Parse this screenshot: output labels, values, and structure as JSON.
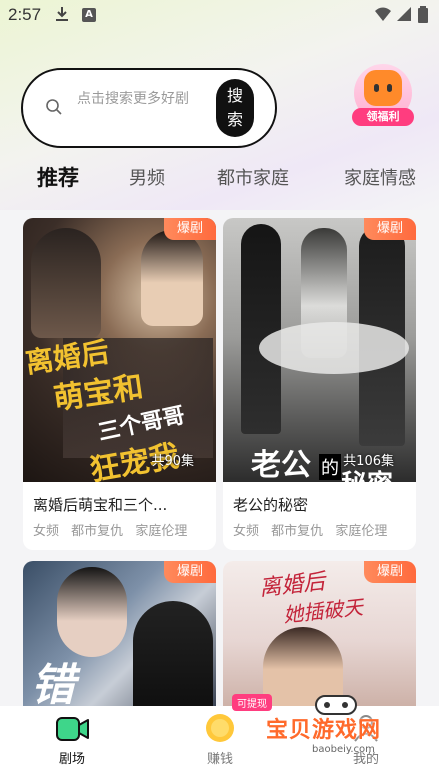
{
  "status_bar": {
    "time": "2:57"
  },
  "search": {
    "placeholder": "点击搜索更多好剧",
    "button_label": "搜索"
  },
  "welfare": {
    "label": "领福利"
  },
  "tabs": [
    {
      "label": "推荐",
      "active": true
    },
    {
      "label": "男频",
      "active": false
    },
    {
      "label": "都市家庭",
      "active": false
    },
    {
      "label": "家庭情感",
      "active": false
    }
  ],
  "cards": [
    {
      "badge": "爆剧",
      "cover_text": [
        "离婚后",
        "萌宝和",
        "三个哥哥",
        "狂宠我"
      ],
      "episodes": "共90集",
      "title": "离婚后萌宝和三个...",
      "tags": [
        "女频",
        "都市复仇",
        "家庭伦理"
      ]
    },
    {
      "badge": "爆剧",
      "cover_text": [
        "老公",
        "的",
        "秘密"
      ],
      "episodes": "共106集",
      "title": "老公的秘密",
      "tags": [
        "女频",
        "都市复仇",
        "家庭伦理"
      ]
    },
    {
      "badge": "爆剧",
      "cover_text": [
        "错"
      ],
      "episodes": "",
      "title": "",
      "tags": []
    },
    {
      "badge": "爆剧",
      "cover_text": [
        "离婚后",
        "她插破天"
      ],
      "episodes": "",
      "title": "",
      "tags": []
    }
  ],
  "bottom_nav": [
    {
      "label": "剧场",
      "icon": "video-camera-icon",
      "active": true
    },
    {
      "label": "赚钱",
      "icon": "coin-icon",
      "active": false
    },
    {
      "label": "我的",
      "icon": "user-icon",
      "active": false
    }
  ],
  "watermark": {
    "main": "宝贝游戏网",
    "sub": "baobeiy.com",
    "tag": "可提现"
  },
  "colors": {
    "accent": "#ff6a3d",
    "nav_active": "#3ed68a",
    "badge_pink": "#ff3d7f"
  }
}
